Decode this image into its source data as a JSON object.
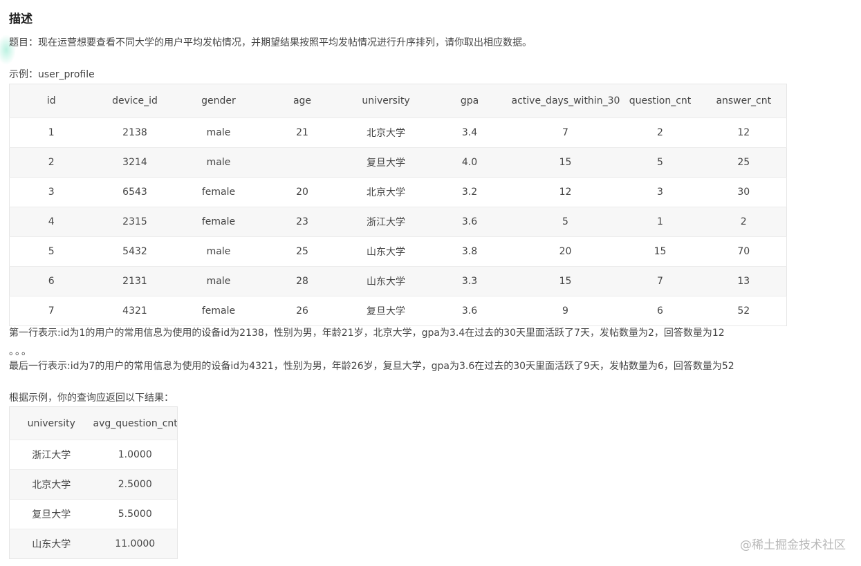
{
  "section_title": "描述",
  "problem": "题目：现在运营想要查看不同大学的用户平均发帖情况，并期望结果按照平均发帖情况进行升序排列，请你取出相应数据。",
  "example_label": "示例：user_profile",
  "profile_table": {
    "headers": [
      "id",
      "device_id",
      "gender",
      "age",
      "university",
      "gpa",
      "active_days_within_30",
      "question_cnt",
      "answer_cnt"
    ],
    "rows": [
      [
        "1",
        "2138",
        "male",
        "21",
        "北京大学",
        "3.4",
        "7",
        "2",
        "12"
      ],
      [
        "2",
        "3214",
        "male",
        "",
        "复旦大学",
        "4.0",
        "15",
        "5",
        "25"
      ],
      [
        "3",
        "6543",
        "female",
        "20",
        "北京大学",
        "3.2",
        "12",
        "3",
        "30"
      ],
      [
        "4",
        "2315",
        "female",
        "23",
        "浙江大学",
        "3.6",
        "5",
        "1",
        "2"
      ],
      [
        "5",
        "5432",
        "male",
        "25",
        "山东大学",
        "3.8",
        "20",
        "15",
        "70"
      ],
      [
        "6",
        "2131",
        "male",
        "28",
        "山东大学",
        "3.3",
        "15",
        "7",
        "13"
      ],
      [
        "7",
        "4321",
        "female",
        "26",
        "复旦大学",
        "3.6",
        "9",
        "6",
        "52"
      ]
    ]
  },
  "first_row_desc": "第一行表示:id为1的用户的常用信息为使用的设备id为2138，性别为男，年龄21岁，北京大学，gpa为3.4在过去的30天里面活跃了7天，发帖数量为2，回答数量为12",
  "ellipsis": "。。。",
  "last_row_desc": "最后一行表示:id为7的用户的常用信息为使用的设备id为4321，性别为男，年龄26岁，复旦大学，gpa为3.6在过去的30天里面活跃了9天，发帖数量为6，回答数量为52",
  "result_label": "根据示例，你的查询应返回以下结果：",
  "result_table": {
    "headers": [
      "university",
      "avg_question_cnt"
    ],
    "rows": [
      [
        "浙江大学",
        "1.0000"
      ],
      [
        "北京大学",
        "2.5000"
      ],
      [
        "复旦大学",
        "5.5000"
      ],
      [
        "山东大学",
        "11.0000"
      ]
    ]
  },
  "watermark": "@稀土掘金技术社区"
}
